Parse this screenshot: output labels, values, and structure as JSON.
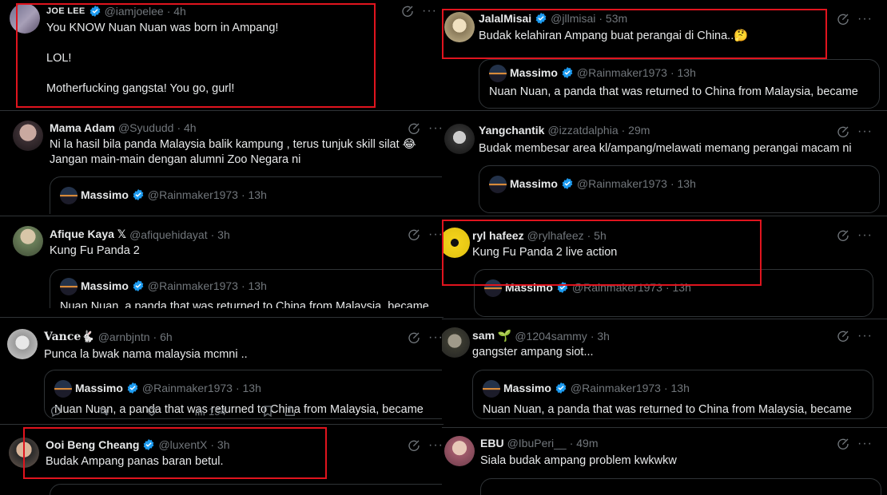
{
  "posts_left": [
    {
      "name": "JOE LEE",
      "handle": "@iamjoelee",
      "time": "· 4h",
      "lines": [
        "You KNOW  Nuan Nuan was born in Ampang!",
        "LOL!",
        "Motherfucking gangsta! You go, gurl!"
      ]
    },
    {
      "name": "Mama Adam",
      "handle": "@Syududd",
      "time": "· 4h",
      "lines": [
        "Ni la hasil bila panda Malaysia balik kampung , terus tunjuk skill silat 😂",
        "Jangan main-main dengan alumni Zoo Negara ni"
      ],
      "quote": {
        "name": "Massimo",
        "handle": "@Rainmaker1973",
        "time": "· 13h"
      }
    },
    {
      "name": "Afique Kaya 𝕏",
      "handle": "@afiquehidayat",
      "time": "· 3h",
      "lines": [
        "Kung Fu Panda 2"
      ],
      "quote": {
        "name": "Massimo",
        "handle": "@Rainmaker1973",
        "time": "· 13h",
        "text": "Nuan Nuan, a panda that was returned to China from Malaysia, became"
      }
    },
    {
      "name": "Vance🐇",
      "handle": "@arnbjntn",
      "time": "· 6h",
      "lines": [
        "Punca la bwak nama malaysia mcmni .."
      ],
      "quote": {
        "name": "Massimo",
        "handle": "@Rainmaker1973",
        "time": "· 13h",
        "text": "Nuan Nuan, a panda that was returned to China from Malaysia, became"
      },
      "views": "154"
    },
    {
      "name": "Ooi Beng Cheang",
      "handle": "@luxentX",
      "time": "· 3h",
      "lines": [
        "Budak Ampang panas baran betul."
      ]
    }
  ],
  "posts_right": [
    {
      "name": "JalalMisai",
      "handle": "@jllmisai",
      "time": "· 53m",
      "lines": [
        "Budak kelahiran Ampang buat perangai di China..🤔"
      ],
      "quote": {
        "name": "Massimo",
        "handle": "@Rainmaker1973",
        "time": "· 13h",
        "text": "Nuan Nuan, a panda that was returned to China from Malaysia, became"
      }
    },
    {
      "name": "Yangchantik",
      "handle": "@izzatdalphia",
      "time": "· 29m",
      "lines": [
        "Budak membesar area kl/ampang/melawati memang perangai macam ni"
      ],
      "quote": {
        "name": "Massimo",
        "handle": "@Rainmaker1973",
        "time": "· 13h"
      }
    },
    {
      "name": "ryl hafeez",
      "handle": "@rylhafeez",
      "time": "· 5h",
      "lines": [
        "Kung Fu Panda 2 live action"
      ],
      "quote": {
        "name": "Massimo",
        "handle": "@Rainmaker1973",
        "time": "· 13h"
      }
    },
    {
      "name": "sam 🌱",
      "handle": "@1204sammy",
      "time": "· 3h",
      "lines": [
        "gangster ampang siot..."
      ],
      "quote": {
        "name": "Massimo",
        "handle": "@Rainmaker1973",
        "time": "· 13h",
        "text": "Nuan Nuan, a panda that was returned to China from Malaysia, became"
      }
    },
    {
      "name": "EBU",
      "handle": "@IbuPeri__",
      "time": "· 49m",
      "lines": [
        "Siala budak ampang problem kwkwkw"
      ]
    }
  ],
  "colors": {
    "background": "#000000",
    "text": "#e7e9ea",
    "muted": "#71767b",
    "verified": "#1d9bf0",
    "highlight": "#e0141e",
    "border": "#2f3336"
  },
  "icons": [
    "verified-badge-icon",
    "grok-icon",
    "more-icon",
    "reply-icon",
    "retweet-icon",
    "like-icon",
    "views-icon",
    "bookmark-icon",
    "share-icon"
  ]
}
